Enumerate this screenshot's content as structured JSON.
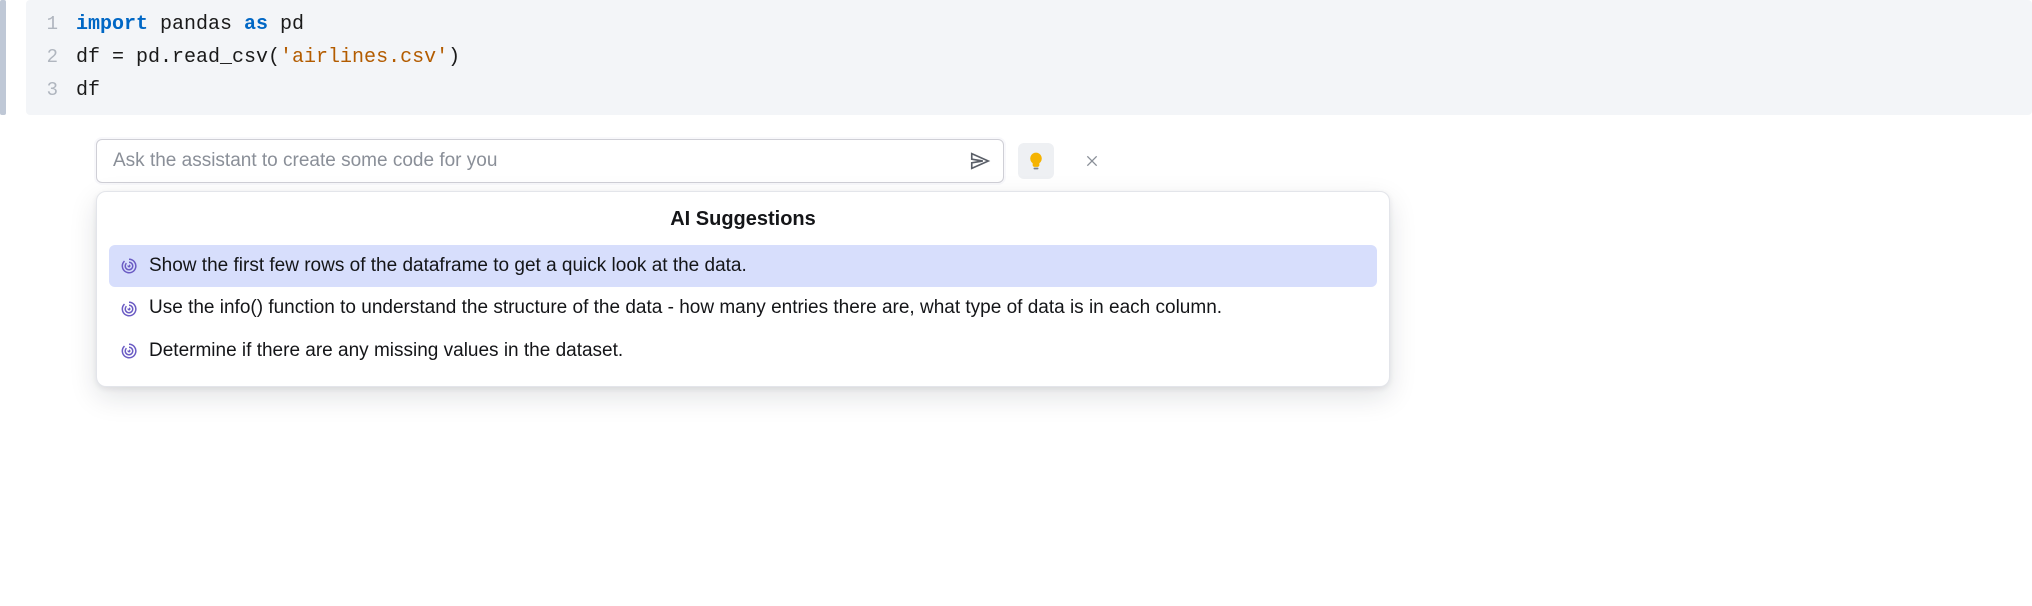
{
  "code": {
    "lines": [
      {
        "n": "1",
        "tokens": [
          {
            "t": "import",
            "c": "kw"
          },
          {
            "t": " pandas ",
            "c": ""
          },
          {
            "t": "as",
            "c": "kw"
          },
          {
            "t": " pd",
            "c": ""
          }
        ]
      },
      {
        "n": "2",
        "tokens": [
          {
            "t": "df = pd.read_csv(",
            "c": ""
          },
          {
            "t": "'airlines.csv'",
            "c": "str"
          },
          {
            "t": ")",
            "c": ""
          }
        ]
      },
      {
        "n": "3",
        "tokens": [
          {
            "t": "df",
            "c": ""
          }
        ]
      }
    ]
  },
  "assistant": {
    "placeholder": "Ask the assistant to create some code for you"
  },
  "suggestions": {
    "title": "AI Suggestions",
    "items": [
      {
        "text": "Show the first few rows of the dataframe to get a quick look at the data.",
        "selected": true
      },
      {
        "text": "Use the info() function to understand the structure of the data - how many entries there are, what type of data is in each column.",
        "selected": false
      },
      {
        "text": "Determine if there are any missing values in the dataset.",
        "selected": false
      }
    ]
  }
}
